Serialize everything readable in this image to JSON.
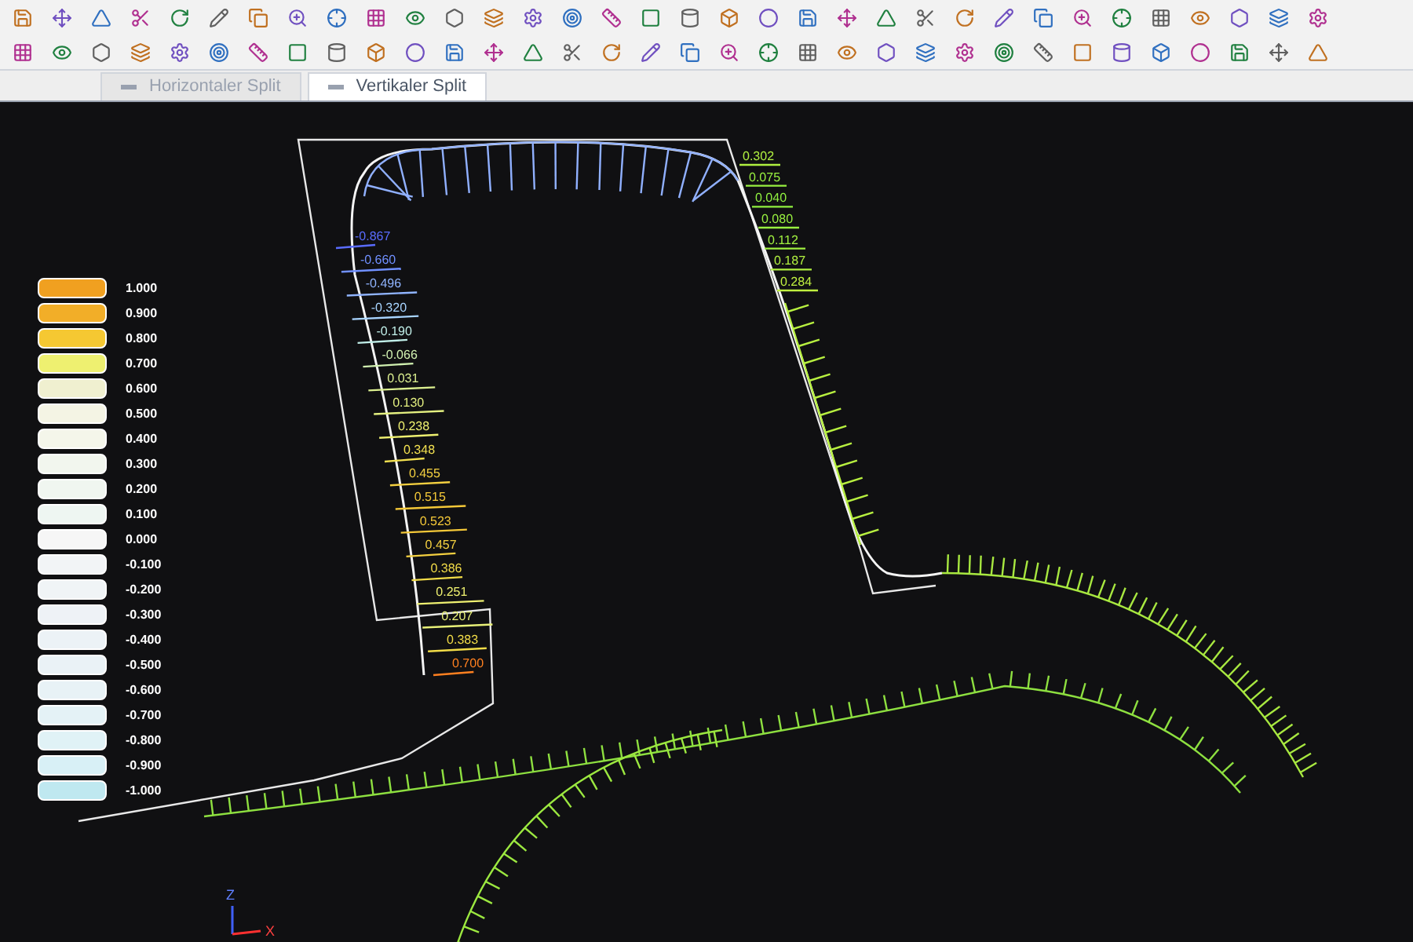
{
  "tabs": [
    {
      "label": "Horizontaler Split",
      "selected": false
    },
    {
      "label": "Vertikaler Split",
      "selected": true
    }
  ],
  "legend": [
    {
      "label": "1.000",
      "color": "#f0a020"
    },
    {
      "label": "0.900",
      "color": "#f2ae28"
    },
    {
      "label": "0.800",
      "color": "#f5c832"
    },
    {
      "label": "0.700",
      "color": "#eef070"
    },
    {
      "label": "0.600",
      "color": "#f0f0d0"
    },
    {
      "label": "0.500",
      "color": "#f4f4e4"
    },
    {
      "label": "0.400",
      "color": "#f4f6ea"
    },
    {
      "label": "0.300",
      "color": "#f2f6ee"
    },
    {
      "label": "0.200",
      "color": "#f0f6f0"
    },
    {
      "label": "0.100",
      "color": "#eef6f2"
    },
    {
      "label": "0.000",
      "color": "#f6f6f6"
    },
    {
      "label": "-0.100",
      "color": "#f2f4f6"
    },
    {
      "label": "-0.200",
      "color": "#f0f4f6"
    },
    {
      "label": "-0.300",
      "color": "#eef2f6"
    },
    {
      "label": "-0.400",
      "color": "#ecf2f6"
    },
    {
      "label": "-0.500",
      "color": "#eaf2f6"
    },
    {
      "label": "-0.600",
      "color": "#e8f2f6"
    },
    {
      "label": "-0.700",
      "color": "#e4f2f6"
    },
    {
      "label": "-0.800",
      "color": "#e0f2f6"
    },
    {
      "label": "-0.900",
      "color": "#d8f0f6"
    },
    {
      "label": "-1.000",
      "color": "#bfe8f0"
    }
  ],
  "left_profile": [
    {
      "label": "-0.867",
      "color": "#5a6cff"
    },
    {
      "label": "-0.660",
      "color": "#7090ff"
    },
    {
      "label": "-0.496",
      "color": "#90b4ff"
    },
    {
      "label": "-0.320",
      "color": "#a8d4ff"
    },
    {
      "label": "-0.190",
      "color": "#c0eee8"
    },
    {
      "label": "-0.066",
      "color": "#d0f0b0"
    },
    {
      "label": "0.031",
      "color": "#dcf090"
    },
    {
      "label": "0.130",
      "color": "#e4f080"
    },
    {
      "label": "0.238",
      "color": "#eef070"
    },
    {
      "label": "0.348",
      "color": "#f2e050"
    },
    {
      "label": "0.455",
      "color": "#f4d040"
    },
    {
      "label": "0.515",
      "color": "#f4c838"
    },
    {
      "label": "0.523",
      "color": "#f4c838"
    },
    {
      "label": "0.457",
      "color": "#f4d040"
    },
    {
      "label": "0.386",
      "color": "#f2dc48"
    },
    {
      "label": "0.251",
      "color": "#eef070"
    },
    {
      "label": "0.207",
      "color": "#e8f078"
    },
    {
      "label": "0.383",
      "color": "#f2dc48"
    },
    {
      "label": "0.700",
      "color": "#ff8020"
    }
  ],
  "right_profile": [
    {
      "label": "0.302",
      "color": "#b0f040"
    },
    {
      "label": "0.075",
      "color": "#98f040"
    },
    {
      "label": "0.040",
      "color": "#90f040"
    },
    {
      "label": "0.080",
      "color": "#98f040"
    },
    {
      "label": "0.112",
      "color": "#a0f040"
    },
    {
      "label": "0.187",
      "color": "#b0f040"
    },
    {
      "label": "0.284",
      "color": "#c0f040"
    }
  ],
  "axes": [
    {
      "label": "Z"
    },
    {
      "label": "X"
    }
  ]
}
